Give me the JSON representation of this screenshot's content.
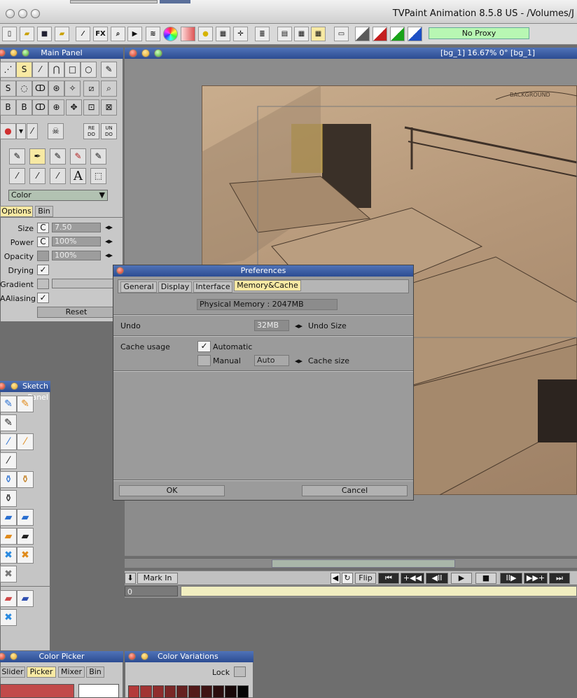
{
  "window": {
    "title": "TVPaint Animation 8.5.8 US - /Volumes/J"
  },
  "toolbar": {
    "fx": "FX",
    "proxy": "No Proxy",
    "colors": [
      "#5b5b5b",
      "#c41f1f",
      "#1aa31a",
      "#1d4fc4"
    ]
  },
  "canvas": {
    "status": "[bg_1]   16.67%   0°   [bg_1]",
    "sketch_note": "BACKGROUND"
  },
  "main_panel": {
    "title": "Main Panel",
    "redo": "RE\nDO",
    "undo": "UN\nDO",
    "mode": "Color",
    "tabs": [
      "Options",
      "Bin"
    ],
    "size_label": "Size",
    "size_c": "C",
    "size_value": "7.50",
    "power_label": "Power",
    "power_c": "C",
    "power_value": "100%",
    "opacity_label": "Opacity",
    "opacity_value": "100%",
    "drying_label": "Drying",
    "gradient_label": "Gradient",
    "aliasing_label": "AAliasing",
    "reset": "Reset"
  },
  "sketch_panel": {
    "title": "Sketch Panel"
  },
  "preferences": {
    "title": "Preferences",
    "tabs": [
      "General",
      "Display",
      "Interface",
      "Memory&Cache"
    ],
    "physical_memory": "Physical Memory : 2047MB",
    "undo_label": "Undo",
    "undo_value": "32MB",
    "undo_size_label": "Undo Size",
    "cache_label": "Cache usage",
    "automatic_label": "Automatic",
    "manual_label": "Manual",
    "cache_value": "Auto",
    "cache_size_label": "Cache size",
    "ok": "OK",
    "cancel": "Cancel"
  },
  "timeline": {
    "mark_in": "Mark In",
    "flip": "Flip",
    "frame": "0"
  },
  "color_picker": {
    "title": "Color Picker",
    "tabs": [
      "Slider",
      "Picker",
      "Mixer",
      "Bin"
    ],
    "main_color": "#c24a4a"
  },
  "color_variations": {
    "title": "Color Variations",
    "lock": "Lock",
    "swatches": [
      "#b43a3a",
      "#a23434",
      "#8f2d2d",
      "#7a2727",
      "#662020",
      "#521a1a",
      "#3f1414",
      "#2c0e0e",
      "#180808",
      "#050505"
    ]
  }
}
